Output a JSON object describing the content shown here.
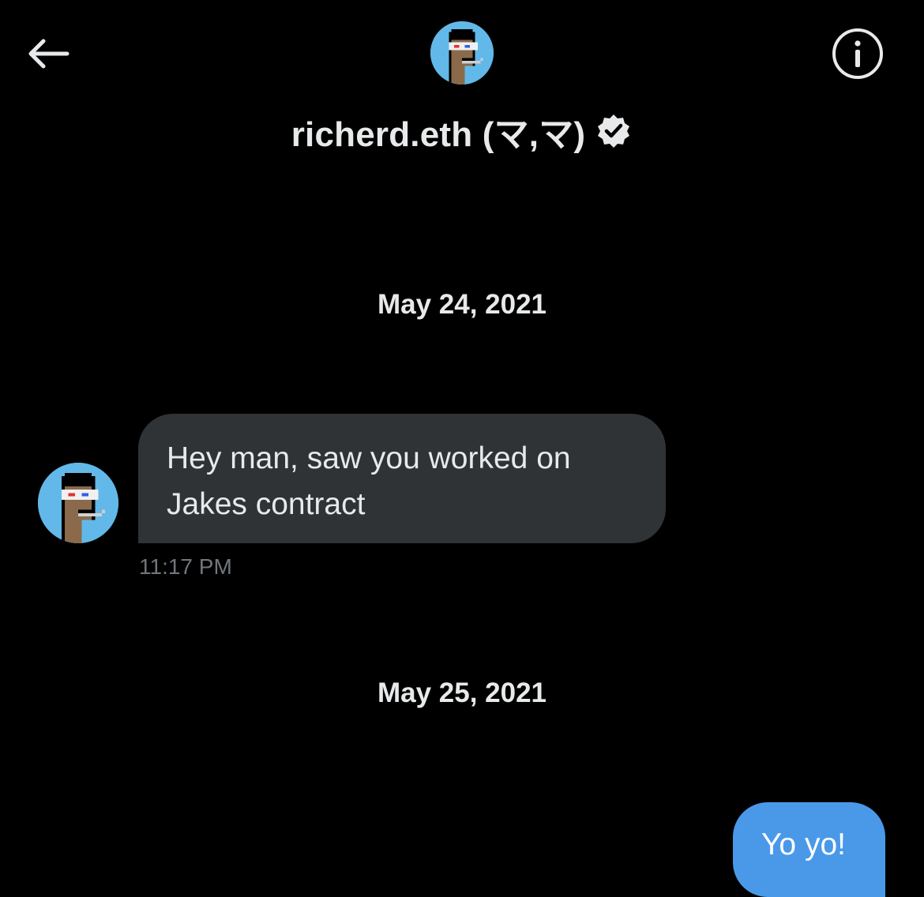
{
  "header": {
    "back_icon": "arrow-left-icon",
    "info_icon": "info-circle-icon",
    "contact_name": "richerd.eth (マ,マ)",
    "verified_icon": "verified-badge-icon"
  },
  "conversation": {
    "dates": [
      "May 24, 2021",
      "May 25, 2021"
    ],
    "incoming": {
      "lines": [
        "Hey man, saw you worked on",
        "Jakes contract"
      ],
      "time": "11:17 PM"
    },
    "outgoing": {
      "text": "Yo yo!"
    }
  },
  "colors": {
    "background": "#000000",
    "incoming_bubble": "#2f3336",
    "outgoing_bubble": "#4a99e9",
    "avatar_bg": "#62b8e8",
    "muted_text": "#71767b"
  }
}
